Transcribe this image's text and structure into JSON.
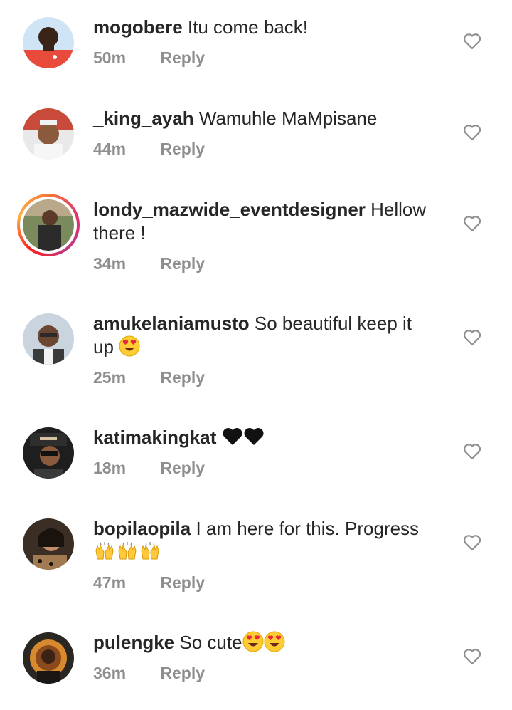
{
  "comments": [
    {
      "username": "mogobere",
      "text": "Itu come back!",
      "time": "50m",
      "reply_label": "Reply",
      "avatar_colors": [
        "#e84a3c",
        "#cfe4f5"
      ]
    },
    {
      "username": "_king_ayah",
      "text": "Wamuhle MaMpisane",
      "time": "44m",
      "reply_label": "Reply",
      "avatar_colors": [
        "#f1f1f1",
        "#c84a3a"
      ]
    },
    {
      "username": "londy_mazwide_eventdesigner",
      "text": "Hellow",
      "text_line2": "there !",
      "time": "34m",
      "reply_label": "Reply",
      "avatar_colors": [
        "#2b2b2b",
        "#7a8a5c"
      ]
    },
    {
      "username": "amukelaniamusto",
      "text": "So beautiful keep it",
      "text_line2": "up",
      "time": "25m",
      "reply_label": "Reply",
      "avatar_colors": [
        "#c9d4de",
        "#3a3a3a"
      ]
    },
    {
      "username": "katimakingkat",
      "text": "",
      "time": "18m",
      "reply_label": "Reply",
      "avatar_colors": [
        "#1e1e1e",
        "#d6c1a1"
      ]
    },
    {
      "username": "bopilaopila",
      "text": "I am here for this. Progress",
      "time": "47m",
      "reply_label": "Reply",
      "avatar_colors": [
        "#3b2e24",
        "#c48e6b"
      ]
    },
    {
      "username": "pulengke",
      "text": "So cute",
      "time": "36m",
      "reply_label": "Reply",
      "avatar_colors": [
        "#2a2622",
        "#d7892e"
      ]
    }
  ],
  "icons": {
    "like": "heart-outline-icon",
    "emoji_heart_eyes": "smiling-face-with-heart-eyes",
    "emoji_black_heart": "black-heart",
    "emoji_raising_hands": "raising-hands"
  },
  "colors": {
    "username": "#262626",
    "meta": "#8e8e8e",
    "heart_outline": "#8e8e8e"
  }
}
